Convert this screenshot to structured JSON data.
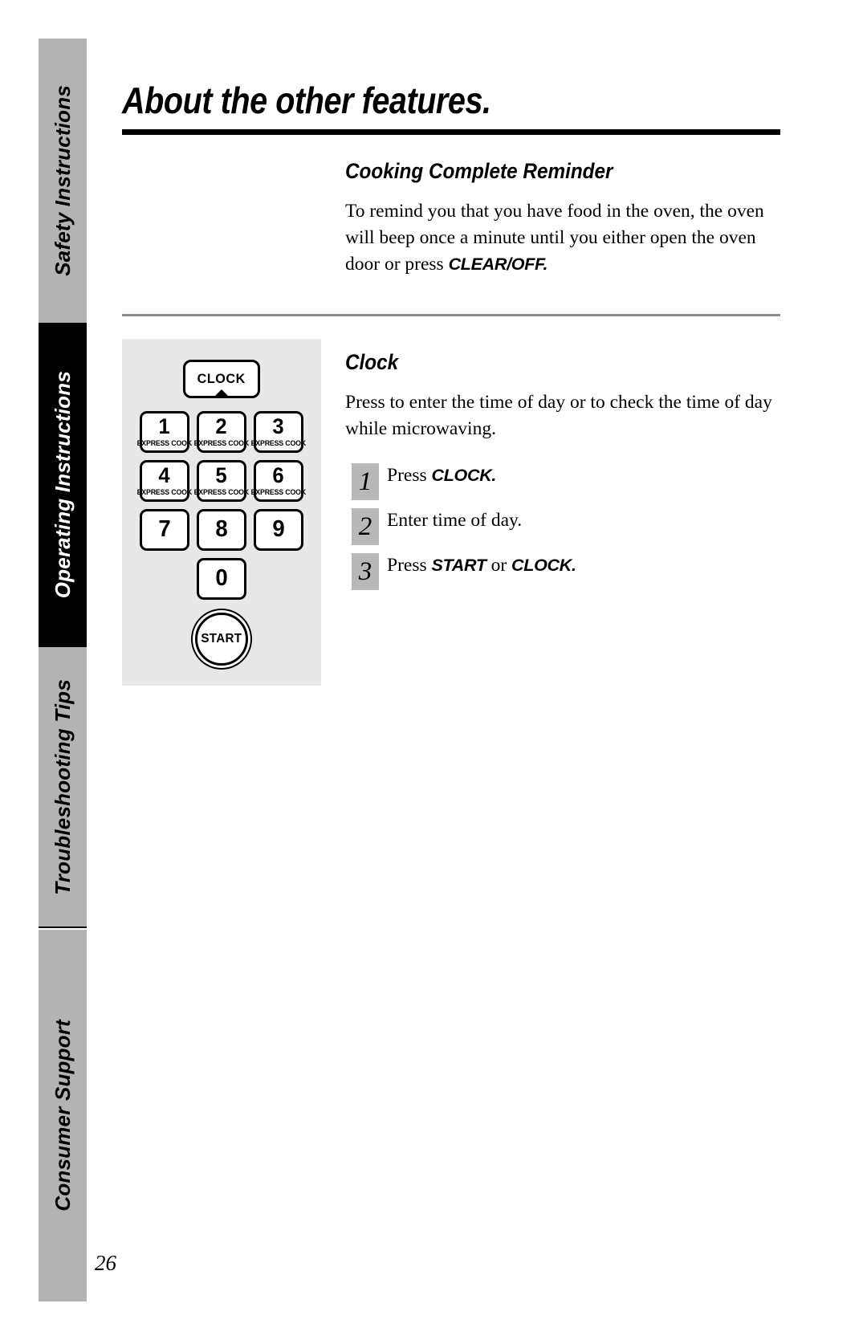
{
  "page": {
    "number": "26",
    "title": "About the other features."
  },
  "sidebar": {
    "tabs": [
      {
        "label": "Safety Instructions",
        "state": "inactive"
      },
      {
        "label": "Operating Instructions",
        "state": "active"
      },
      {
        "label": "Troubleshooting Tips",
        "state": "inactive"
      },
      {
        "label": "Consumer Support",
        "state": "inactive"
      }
    ]
  },
  "sections": {
    "reminder": {
      "heading": "Cooking Complete Reminder",
      "body_part1": "To remind you that you have food in the oven, the oven will beep once a minute until you either open the oven door or press ",
      "body_keyword": "CLEAR/OFF."
    },
    "clock": {
      "heading": "Clock",
      "body": "Press to enter the time of day or to check the time of day while microwaving.",
      "steps": [
        {
          "number": "1",
          "text_before": "Press ",
          "keyword1": "CLOCK.",
          "text_middle": "",
          "keyword2": "",
          "text_after": ""
        },
        {
          "number": "2",
          "text_before": "Enter time of day.",
          "keyword1": "",
          "text_middle": "",
          "keyword2": "",
          "text_after": ""
        },
        {
          "number": "3",
          "text_before": "Press ",
          "keyword1": "START",
          "text_middle": " or ",
          "keyword2": "CLOCK.",
          "text_after": ""
        }
      ]
    }
  },
  "keypad": {
    "clock_button": "CLOCK",
    "express_cook_label": "EXPRESS COOK",
    "keys": [
      {
        "digit": "1",
        "sub": "EXPRESS COOK"
      },
      {
        "digit": "2",
        "sub": "EXPRESS COOK"
      },
      {
        "digit": "3",
        "sub": "EXPRESS COOK"
      },
      {
        "digit": "4",
        "sub": "EXPRESS COOK"
      },
      {
        "digit": "5",
        "sub": "EXPRESS COOK"
      },
      {
        "digit": "6",
        "sub": "EXPRESS COOK"
      },
      {
        "digit": "7",
        "sub": ""
      },
      {
        "digit": "8",
        "sub": ""
      },
      {
        "digit": "9",
        "sub": ""
      }
    ],
    "zero_key": "0",
    "start_button": "START"
  },
  "colors": {
    "tab_inactive_bg": "#b3b3b3",
    "tab_active_bg": "#000000",
    "panel_bg": "#e8e8e8",
    "step_chip_bg": "#b8b8b8",
    "rule_gray": "#8c8c8c"
  }
}
